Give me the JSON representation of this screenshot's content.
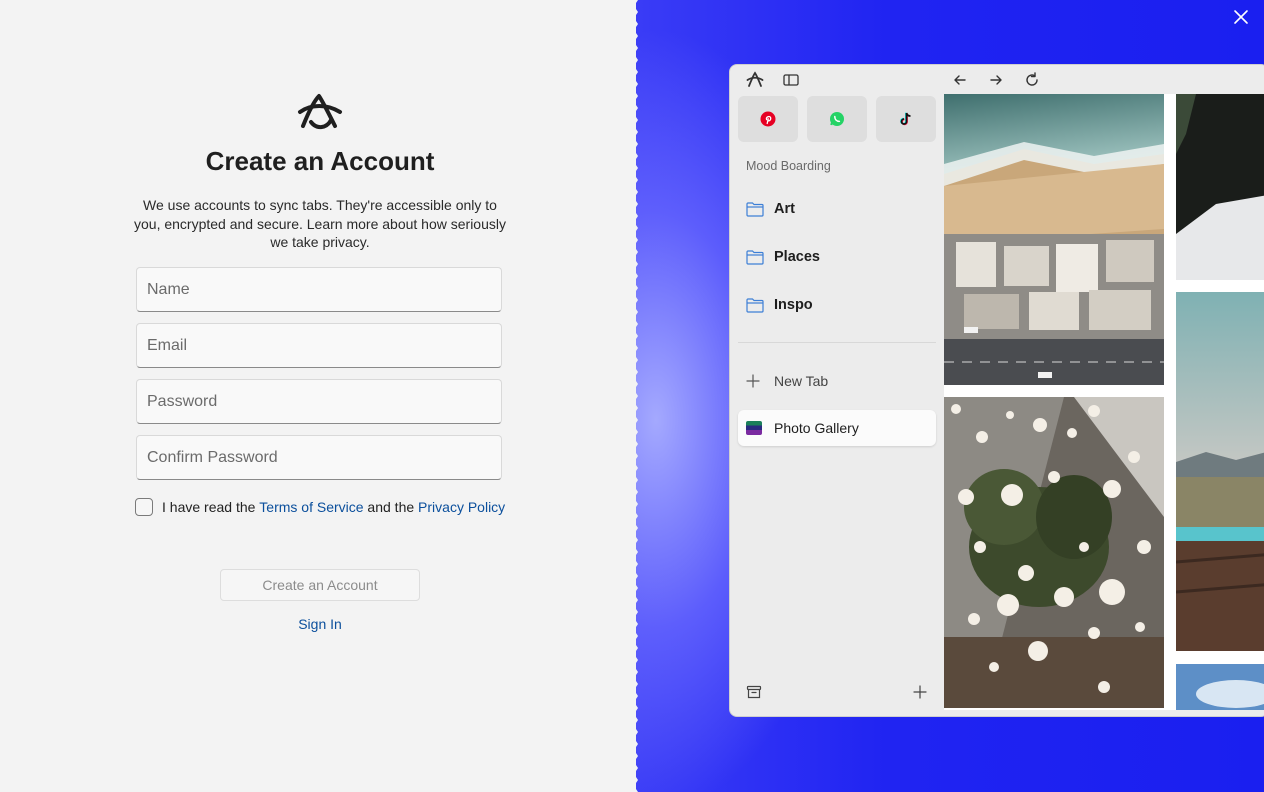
{
  "signup": {
    "title": "Create an Account",
    "description": "We use accounts to sync tabs. They're accessible only to you, encrypted and secure. Learn more about how seriously we take privacy.",
    "fields": {
      "name_placeholder": "Name",
      "email_placeholder": "Email",
      "password_placeholder": "Password",
      "confirm_placeholder": "Confirm Password"
    },
    "terms": {
      "prefix": "I have read the ",
      "tos_link": "Terms of Service",
      "middle": " and the ",
      "privacy_link": "Privacy Policy"
    },
    "create_button": "Create an Account",
    "signin_link": "Sign In"
  },
  "browser": {
    "favorites": [
      "pinterest-icon",
      "whatsapp-icon",
      "tiktok-icon"
    ],
    "section_label": "Mood Boarding",
    "folders": [
      "Art",
      "Places",
      "Inspo"
    ],
    "new_tab": "New Tab",
    "active_tab": "Photo Gallery"
  },
  "colors": {
    "accent_link": "#0b4f9c",
    "right_background": "#2024f2",
    "pinterest": "#e60023",
    "whatsapp": "#25d366"
  }
}
